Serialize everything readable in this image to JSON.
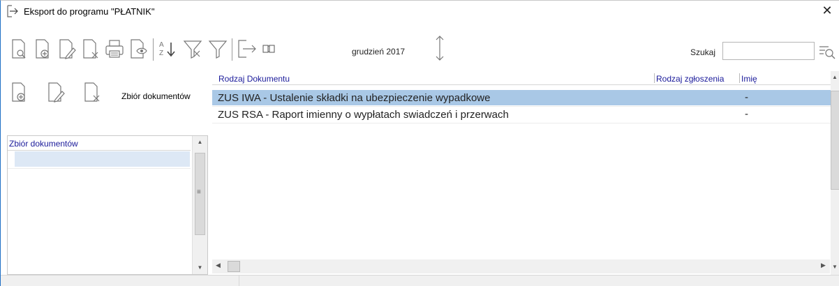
{
  "window": {
    "title": "Eksport do programu \"PŁATNIK\"",
    "close_label": "✕"
  },
  "toolbar": {
    "buttons": [
      {
        "name": "preview-document-icon"
      },
      {
        "name": "add-document-icon"
      },
      {
        "name": "edit-document-icon"
      },
      {
        "name": "delete-document-icon"
      },
      {
        "name": "print-icon"
      },
      {
        "name": "document-details-icon"
      },
      {
        "name": "sort-az-icon"
      },
      {
        "name": "filter-clear-icon"
      },
      {
        "name": "filter-icon"
      },
      {
        "name": "export-icon"
      },
      {
        "name": "book-icon"
      },
      {
        "name": "vertical-resize-icon"
      }
    ],
    "period_label": "grudzień 2017",
    "search_label": "Szukaj",
    "search_value": ""
  },
  "left_panel": {
    "toolbar_label": "Zbiór dokumentów",
    "grid_header": "Zbiór dokumentów",
    "rows": [
      ""
    ]
  },
  "main_grid": {
    "columns": [
      "Rodzaj Dokumentu",
      "Rodzaj zgłoszenia",
      "Imię"
    ],
    "rows": [
      {
        "doc_type": "ZUS IWA - Ustalenie składki na ubezpieczenie wypadkowe",
        "report_type": "",
        "first_name": "-",
        "selected": true
      },
      {
        "doc_type": "ZUS RSA - Raport imienny o wypłatach swiadczeń i przerwach",
        "report_type": "",
        "first_name": "-",
        "selected": false
      }
    ]
  }
}
